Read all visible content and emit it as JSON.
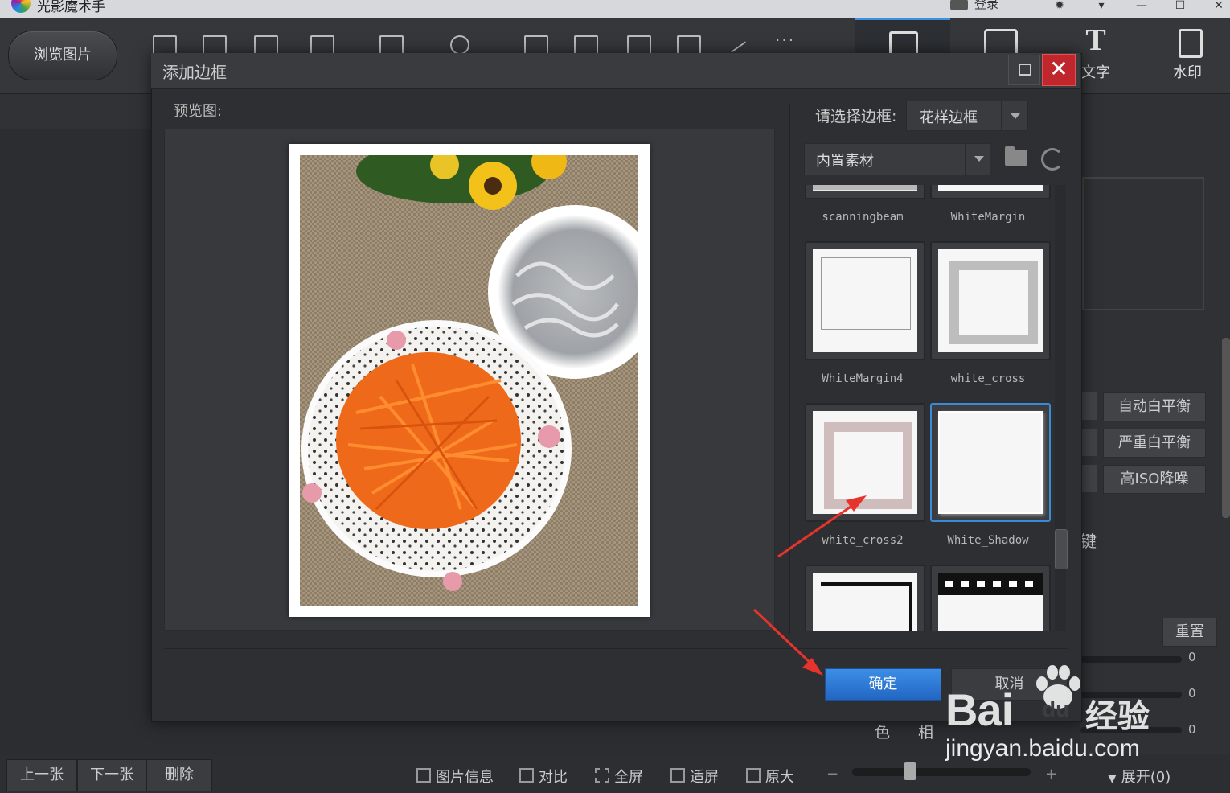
{
  "app": {
    "title": "光影魔术手",
    "login": "登录"
  },
  "toolbar": {
    "browse_label": "浏览图片",
    "more_label": "···",
    "right_tabs": [
      {
        "label": ""
      },
      {
        "label": ""
      },
      {
        "label": "文字",
        "glyph": "T"
      },
      {
        "label": "水印"
      }
    ]
  },
  "dialog": {
    "title": "添加边框",
    "close_label": "✕",
    "preview_label": "预览图:",
    "select_label": "请选择边框:",
    "border_type": "花样边框",
    "source": "内置素材",
    "thumbnails": [
      {
        "name": "scanningbeam",
        "style": "partial"
      },
      {
        "name": "WhiteMargin",
        "style": "partial"
      },
      {
        "name": "WhiteMargin4",
        "style": "margin"
      },
      {
        "name": "white_cross",
        "style": "cross-gray"
      },
      {
        "name": "white_cross2",
        "style": "cross-pink"
      },
      {
        "name": "White_Shadow",
        "style": "shadow",
        "selected": true
      },
      {
        "name": "",
        "style": "black-corner"
      },
      {
        "name": "",
        "style": "film"
      }
    ],
    "ok_label": "确定",
    "cancel_label": "取消"
  },
  "right_panel": {
    "buttons": [
      "自动白平衡",
      "严重白平衡",
      "高ISO降噪"
    ],
    "reset_label": "重置",
    "slider_values": [
      "0",
      "0",
      "0"
    ],
    "stray_char": "键",
    "hue_label_1": "色",
    "hue_label_2": "相"
  },
  "bottombar": {
    "prev_label": "上一张",
    "next_label": "下一张",
    "delete_label": "删除",
    "info_label": "图片信息",
    "compare_label": "对比",
    "fullscreen_label": "全屏",
    "fit_label": "适屏",
    "original_label": "原大",
    "zoom_minus": "−",
    "zoom_plus": "+",
    "expand_label": "展开(0)"
  },
  "watermark": {
    "brand": "Bai",
    "brand2": "du",
    "suffix": "经验",
    "url": "jingyan.baidu.com"
  },
  "colors": {
    "accent": "#3d8ee5",
    "close": "#c0272d",
    "annotation_arrow": "#e8332d"
  }
}
